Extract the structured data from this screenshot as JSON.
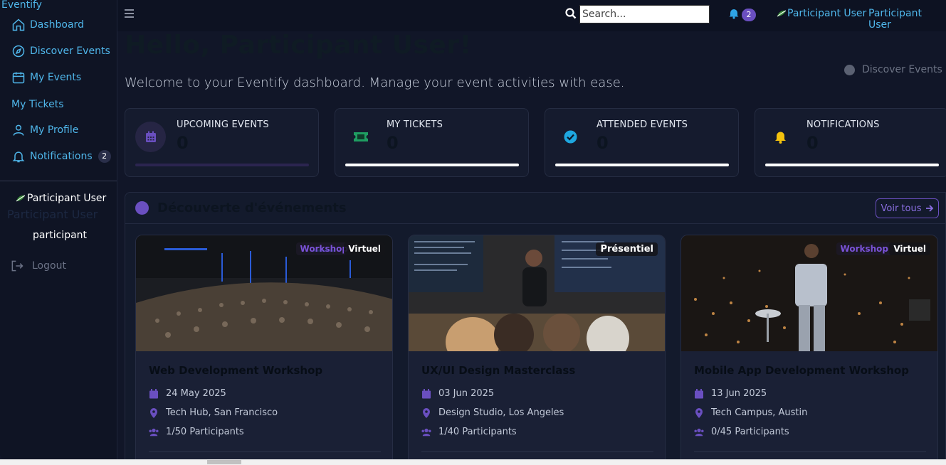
{
  "app": {
    "brand": "Eventify"
  },
  "sidebar": {
    "items": [
      {
        "label": "Dashboard",
        "icon": "home-icon"
      },
      {
        "label": "Discover Events",
        "icon": "compass-icon"
      },
      {
        "label": "My Events",
        "icon": "calendar-icon"
      },
      {
        "label": "My Tickets",
        "icon": ""
      },
      {
        "label": "My Profile",
        "icon": "user-icon"
      },
      {
        "label": "Notifications",
        "icon": "bell-icon",
        "badge": "2"
      }
    ],
    "user_name": "Participant User",
    "user_name_ghost": "Participant User",
    "user_role": "participant",
    "logout_label": "Logout"
  },
  "topbar": {
    "search_placeholder": "Search...",
    "notif_badge": "2",
    "user_name": "Participant User",
    "user_name_2": "Participant User"
  },
  "main": {
    "greeting": "Hello, Participant User!",
    "welcome": "Welcome to your Eventify dashboard. Manage your event activities with ease.",
    "discover_link": "Discover Events",
    "stats": [
      {
        "label": "UPCOMING EVENTS",
        "value": "0",
        "icon": "calendar-icon",
        "color": "#6a4fc0"
      },
      {
        "label": "MY TICKETS",
        "value": "0",
        "icon": "ticket-icon",
        "color": "#1f9d62"
      },
      {
        "label": "ATTENDED EVENTS",
        "value": "0",
        "icon": "check-circle-icon",
        "color": "#1ea7e0"
      },
      {
        "label": "NOTIFICATIONS",
        "value": "0",
        "icon": "bell-icon",
        "color": "#f4c20d"
      }
    ],
    "section_title": "Découverte d'événements",
    "voir_tous": "Voir tous",
    "events": [
      {
        "title": "Web Development Workshop",
        "type": "Workshop",
        "mode": "Virtuel",
        "date": "24 May 2025",
        "location": "Tech Hub, San Francisco",
        "participants": "1/50 Participants"
      },
      {
        "title": "UX/UI Design Masterclass",
        "type": "",
        "mode": "Présentiel",
        "date": "03 Jun 2025",
        "location": "Design Studio, Los Angeles",
        "participants": "1/40 Participants"
      },
      {
        "title": "Mobile App Development Workshop",
        "type": "Workshop",
        "mode": "Virtuel",
        "date": "13 Jun 2025",
        "location": "Tech Campus, Austin",
        "participants": "0/45 Participants"
      }
    ]
  },
  "colors": {
    "accent": "#4fb6ea",
    "purple": "#6a4fc0",
    "bg": "#111628"
  }
}
